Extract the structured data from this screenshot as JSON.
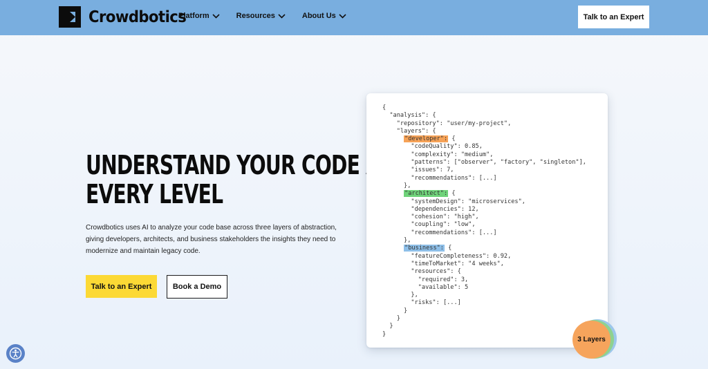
{
  "brand": {
    "name": "Crowdbotics"
  },
  "nav": {
    "items": [
      {
        "label": "Platform"
      },
      {
        "label": "Resources"
      },
      {
        "label": "About Us"
      }
    ],
    "cta_label": "Talk to an Expert"
  },
  "hero": {
    "title_line1": "UNDERSTAND YOUR CODE AT",
    "title_line2": "EVERY LEVEL",
    "description": "Crowdbotics uses AI to analyze your code base across three layers of abstraction, giving developers, architects, and business stakeholders the insights they need to modernize and maintain legacy code.",
    "primary_button": "Talk to an Expert",
    "secondary_button": "Book a Demo"
  },
  "code_sample": {
    "line_01": "{",
    "line_02": "  \"analysis\": {",
    "line_03": "    \"repository\": \"user/my-project\",",
    "line_04": "    \"layers\": {",
    "line_05_indent": "      ",
    "line_05_key": "\"developer\":",
    "line_05_rest": " {",
    "line_06": "        \"codeQuality\": 0.85,",
    "line_07": "        \"complexity\": \"medium\",",
    "line_08": "        \"patterns\": [\"observer\", \"factory\", \"singleton\"],",
    "line_09": "        \"issues\": 7,",
    "line_10": "        \"recommendations\": [...]",
    "line_11": "      },",
    "line_12_indent": "      ",
    "line_12_key": "\"architect\":",
    "line_12_rest": " {",
    "line_13": "        \"systemDesign\": \"microservices\",",
    "line_14": "        \"dependencies\": 12,",
    "line_15": "        \"cohesion\": \"high\",",
    "line_16": "        \"coupling\": \"low\",",
    "line_17": "        \"recommendations\": [...]",
    "line_18": "      },",
    "line_19_indent": "      ",
    "line_19_key": "\"business\":",
    "line_19_rest": " {",
    "line_20": "        \"featureCompleteness\": 0.92,",
    "line_21": "        \"timeToMarket\": \"4 weeks\",",
    "line_22": "        \"resources\": {",
    "line_23": "          \"required\": 3,",
    "line_24": "          \"available\": 5",
    "line_25": "        },",
    "line_26": "        \"risks\": [...]",
    "line_27": "      }",
    "line_28": "    }",
    "line_29": "  }",
    "line_30": "}"
  },
  "badge": {
    "label": "3 Layers"
  },
  "colors": {
    "header_bg": "#79aedf",
    "primary_cta": "#fcd935",
    "developer_highlight": "#f6a257",
    "architect_highlight": "#6fd37a",
    "business_highlight": "#8ebfe8"
  },
  "icons": {
    "logo": "crowdbotics-logo-icon",
    "dropdown": "chevron-down-icon",
    "accessibility": "accessibility-icon"
  }
}
